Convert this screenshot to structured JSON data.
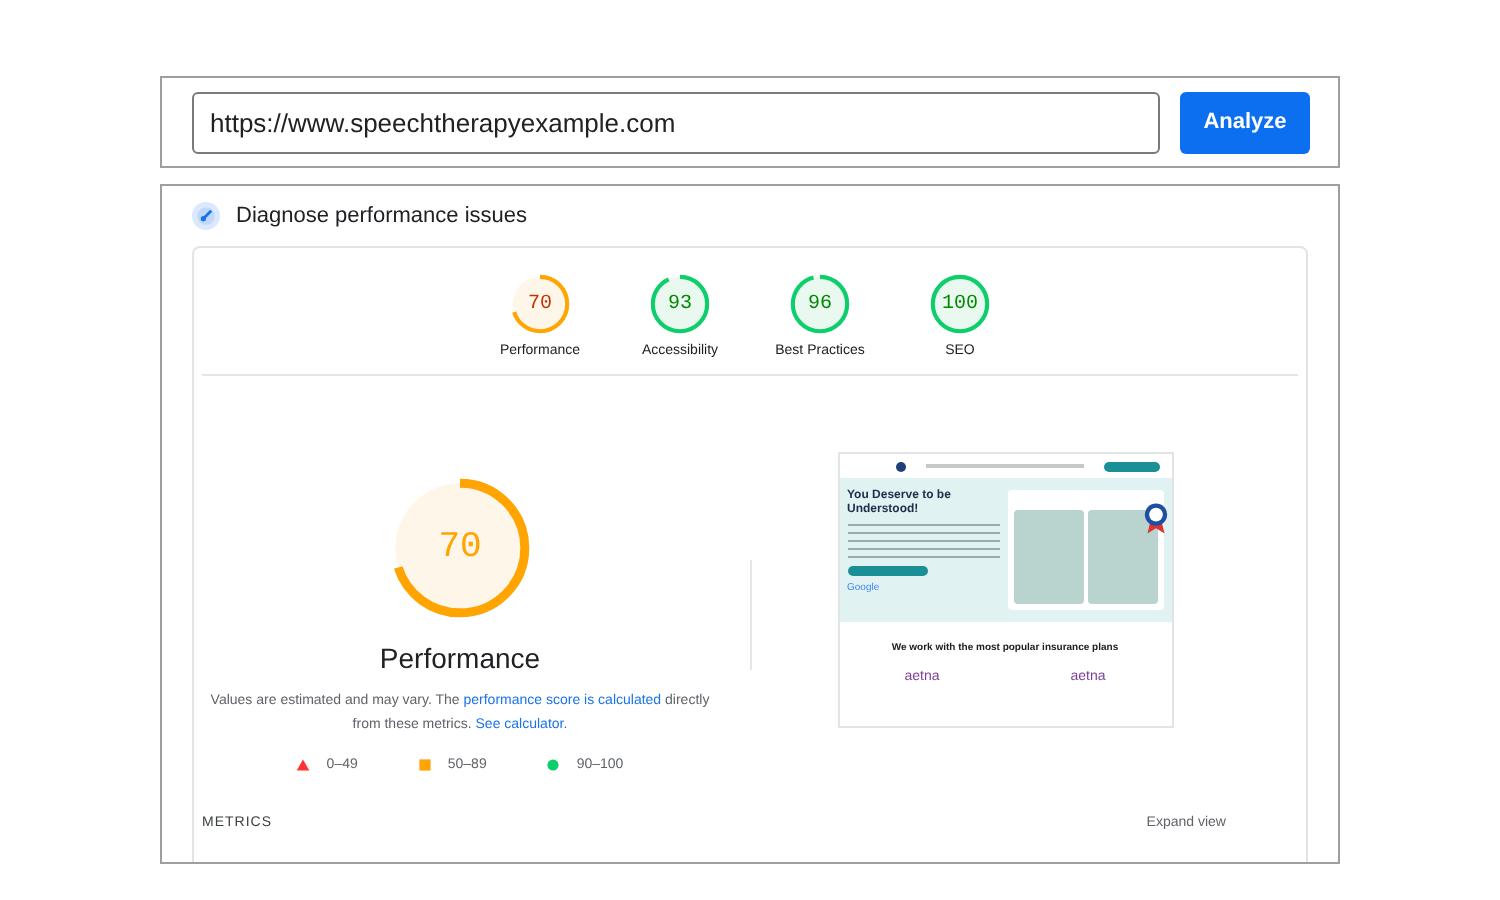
{
  "url_bar": {
    "value": "https://www.speechtherapyexample.com",
    "button": "Analyze"
  },
  "section": {
    "title": "Diagnose performance issues"
  },
  "scores": [
    {
      "label": "Performance",
      "value": "70",
      "level": 0.7
    },
    {
      "label": "Accessibility",
      "value": "93",
      "level": 0.93
    },
    {
      "label": "Best Practices",
      "value": "96",
      "level": 0.96
    },
    {
      "label": "SEO",
      "value": "100",
      "level": 1
    }
  ],
  "main_score": {
    "value": "70",
    "level": 0.7,
    "label": "Performance"
  },
  "description": [
    {
      "kind": "text",
      "text": "Values are estimated and may vary. The "
    },
    {
      "kind": "link",
      "text": "performance score is calculated"
    },
    {
      "kind": "text",
      "text": " directly from these metrics. "
    },
    {
      "kind": "link",
      "text": "See calculator."
    }
  ],
  "legend": [
    {
      "kind": "triangle",
      "range": "0–49",
      "color": "#ff3333"
    },
    {
      "kind": "square",
      "range": "50–89",
      "color": "#ffa400"
    },
    {
      "kind": "circle",
      "range": "90–100",
      "color": "#0cce6b"
    }
  ],
  "preview": {
    "hero_title": "You Deserve to be Understood!",
    "insurance_heading": "We work with the most popular insurance plans",
    "review_logo": "Google",
    "insurers": [
      "aetna",
      "aetna"
    ]
  },
  "metrics": {
    "title": "METRICS",
    "action": "Expand view"
  }
}
